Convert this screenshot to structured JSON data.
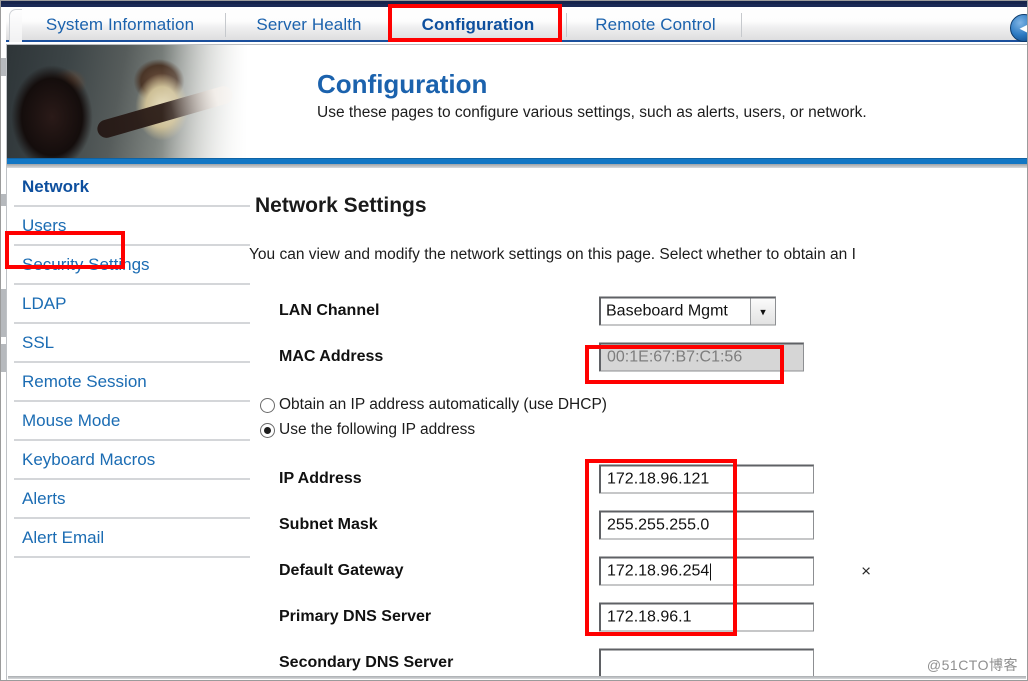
{
  "window": {
    "watermark": "@51CTO博客"
  },
  "tabs": {
    "items": [
      {
        "label": "System Information",
        "active": false
      },
      {
        "label": "Server Health",
        "active": false
      },
      {
        "label": "Configuration",
        "active": true
      },
      {
        "label": "Remote Control",
        "active": false
      }
    ],
    "nav_icon": "back-arrow-circle-icon",
    "nav_glyph": "◄"
  },
  "banner": {
    "title": "Configuration",
    "subtitle": "Use these pages to configure various settings, such as alerts, users, or network.",
    "photo_alt": "two-technicians-photo"
  },
  "sidebar": {
    "items": [
      {
        "label": "Network",
        "active": true
      },
      {
        "label": "Users",
        "active": false
      },
      {
        "label": "Security Settings",
        "active": false
      },
      {
        "label": "LDAP",
        "active": false
      },
      {
        "label": "SSL",
        "active": false
      },
      {
        "label": "Remote Session",
        "active": false
      },
      {
        "label": "Mouse Mode",
        "active": false
      },
      {
        "label": "Keyboard Macros",
        "active": false
      },
      {
        "label": "Alerts",
        "active": false
      },
      {
        "label": "Alert Email",
        "active": false
      }
    ]
  },
  "main": {
    "title": "Network Settings",
    "description": "You can view and modify the network settings on this page. Select whether to obtain an I",
    "fields": {
      "lan_channel": {
        "label": "LAN Channel",
        "value": "Baseboard Mgmt",
        "options": [
          "Baseboard Mgmt"
        ],
        "arrow_glyph": "▾"
      },
      "mac_address": {
        "label": "MAC Address",
        "value": "00:1E:67:B7:C1:56",
        "disabled": true
      },
      "ip_address": {
        "label": "IP Address",
        "value": "172.18.96.121",
        "placeholder": ""
      },
      "subnet_mask": {
        "label": "Subnet Mask",
        "value": "255.255.255.0",
        "placeholder": ""
      },
      "default_gateway": {
        "label": "Default Gateway",
        "value": "172.18.96.254",
        "placeholder": "",
        "clear_glyph": "×",
        "focused": true
      },
      "primary_dns": {
        "label": "Primary DNS Server",
        "value": "172.18.96.1",
        "placeholder": ""
      },
      "secondary_dns": {
        "label": "Secondary DNS Server",
        "value": "",
        "placeholder": ""
      }
    },
    "radios": [
      {
        "label": "Obtain an IP address automatically (use DHCP)",
        "checked": false
      },
      {
        "label": "Use the following IP address",
        "checked": true
      }
    ]
  },
  "annotations": {
    "color": "#ff0000",
    "boxes": [
      {
        "name": "configuration-tab-highlight"
      },
      {
        "name": "network-sidebar-highlight"
      },
      {
        "name": "mac-address-highlight"
      },
      {
        "name": "ip-fields-highlight"
      }
    ]
  }
}
